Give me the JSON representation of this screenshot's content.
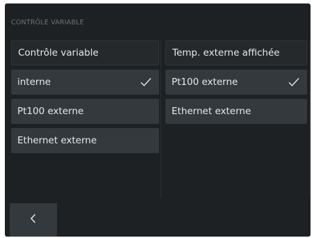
{
  "page": {
    "title": "CONTRÔLE VARIABLE"
  },
  "left_column": {
    "header": "Contrôle variable",
    "options": [
      {
        "label": "interne",
        "selected": true,
        "icon": "check-icon"
      },
      {
        "label": "Pt100 externe",
        "selected": false
      },
      {
        "label": "Ethernet externe",
        "selected": false
      }
    ]
  },
  "right_column": {
    "header": "Temp. externe affichée",
    "options": [
      {
        "label": "Pt100 externe",
        "selected": true,
        "icon": "check-icon"
      },
      {
        "label": "Ethernet externe",
        "selected": false
      }
    ]
  },
  "footer": {
    "back_icon": "chevron-left-icon"
  },
  "colors": {
    "background": "#1d2124",
    "item": "#33393d",
    "header_item": "#25292c",
    "text": "#e8eaeb",
    "title": "#6d7276"
  }
}
